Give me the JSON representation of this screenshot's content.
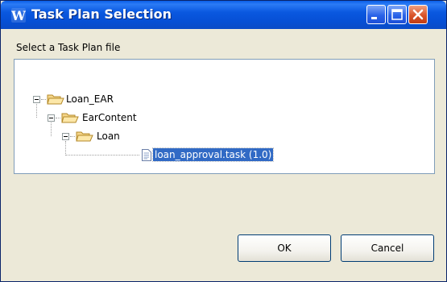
{
  "window": {
    "title": "Task Plan Selection",
    "title_bar_color": "#0a58e0",
    "title_buttons": [
      "minimize-icon",
      "maximize-icon",
      "close-icon"
    ]
  },
  "prompt": "Select a Task Plan file",
  "tree": {
    "nodes": [
      {
        "label": "Loan_EAR",
        "level": 0,
        "expanded": true,
        "icon": "folder-open-icon"
      },
      {
        "label": "EarContent",
        "level": 1,
        "expanded": true,
        "icon": "folder-open-icon"
      },
      {
        "label": "Loan",
        "level": 2,
        "expanded": true,
        "icon": "folder-open-icon"
      },
      {
        "label": "loan_approval.task (1.0)",
        "level": 3,
        "selected": true,
        "icon": "file-icon"
      }
    ],
    "selection_color": "#316ac5"
  },
  "buttons": {
    "ok": "OK",
    "cancel": "Cancel"
  }
}
